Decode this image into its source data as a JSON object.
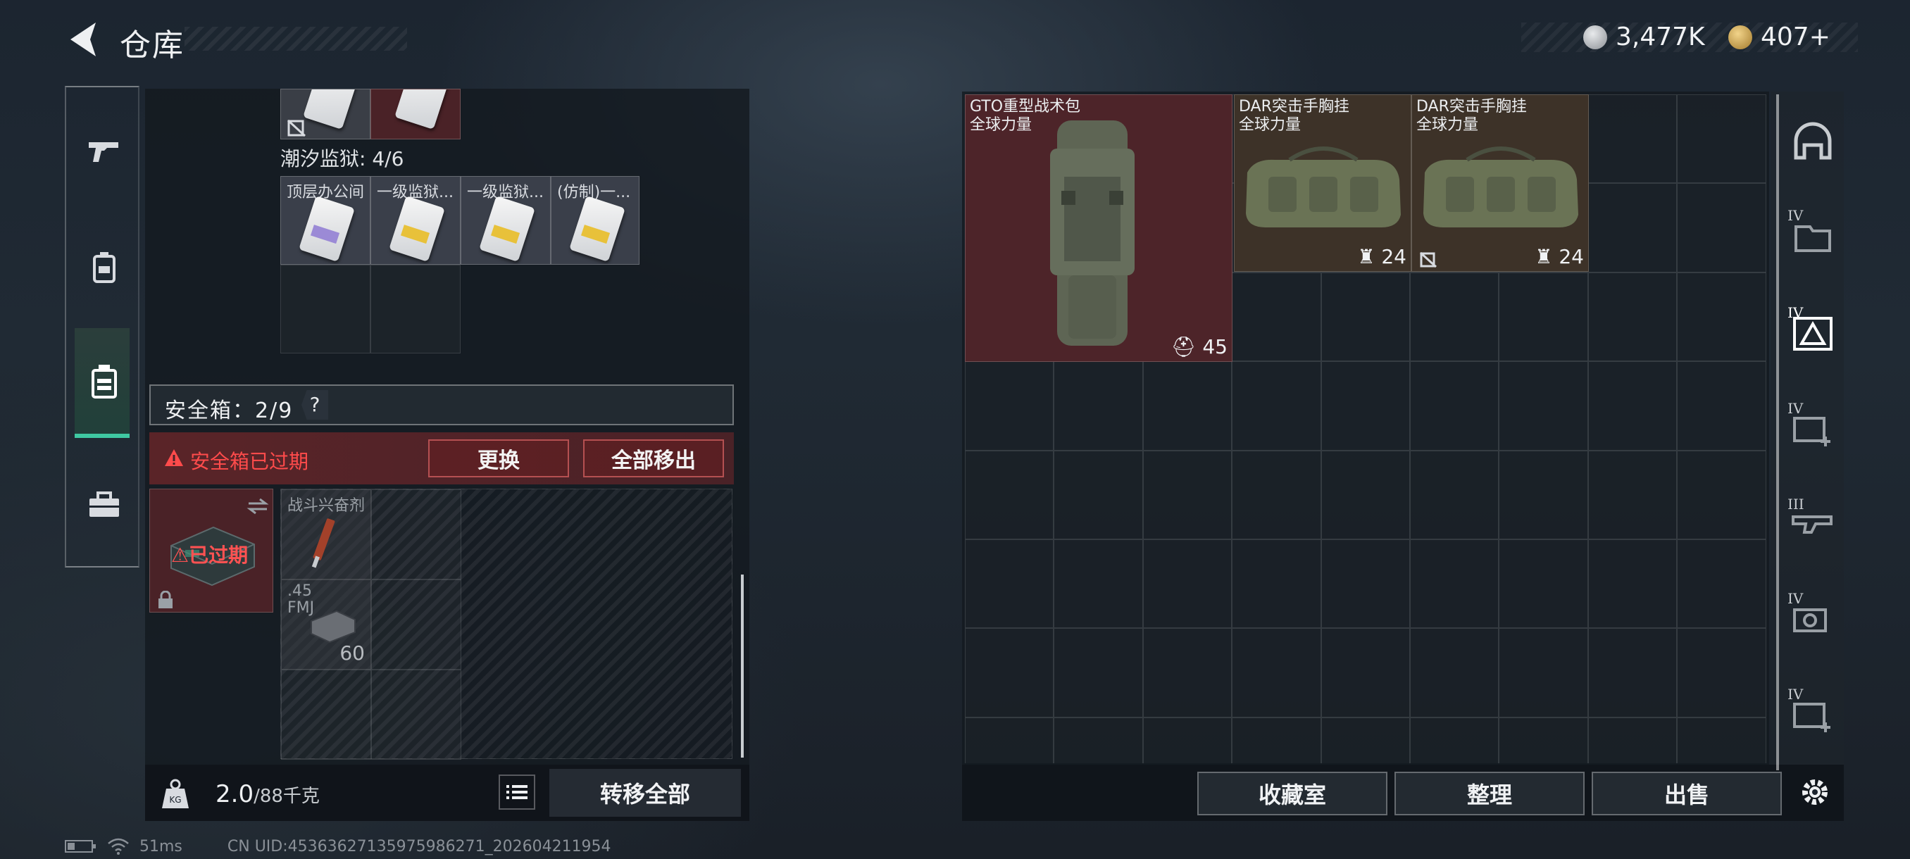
{
  "header": {
    "title": "仓库",
    "currency": [
      {
        "icon": "silver-coin-icon",
        "value": "3,477K"
      },
      {
        "icon": "gold-coin-icon",
        "value": "407+"
      }
    ]
  },
  "left_nav": {
    "items": [
      {
        "name": "weapons",
        "icon": "gun-icon"
      },
      {
        "name": "armor",
        "icon": "backpack-armor-icon"
      },
      {
        "name": "equipment",
        "icon": "chest-rig-icon",
        "active": true
      },
      {
        "name": "tools",
        "icon": "toolbox-icon"
      }
    ]
  },
  "left_panel": {
    "prison_label": "潮汐监狱: 4/6",
    "keycards": [
      {
        "label": "顶层办公间",
        "color": "purple"
      },
      {
        "label": "一级监狱...",
        "color": "yellow"
      },
      {
        "label": "一级监狱...",
        "color": "yellow"
      },
      {
        "label": "(仿制)一...",
        "color": "yellow"
      }
    ],
    "safe_box": {
      "label": "安全箱：2/9",
      "help": "?",
      "expired_text": "安全箱已过期",
      "replace_button": "更换",
      "remove_all_button": "全部移出",
      "thumb_overlay": "已过期",
      "items": [
        {
          "label": "战斗兴奋剂"
        },
        {
          "label": ".45 FMJ",
          "count": "60"
        }
      ]
    },
    "footer": {
      "weight": "2.0",
      "weight_max": "/88千克",
      "transfer_button": "转移全部"
    }
  },
  "right_panel": {
    "items": [
      {
        "name": "GTO重型战术包",
        "subtitle": "全球力量",
        "durability": "45"
      },
      {
        "name": "DAR突击手胸挂",
        "subtitle": "全球力量",
        "durability": "24"
      },
      {
        "name": "DAR突击手胸挂",
        "subtitle": "全球力量",
        "durability": "24"
      }
    ],
    "footer": {
      "collection_button": "收藏室",
      "sort_button": "整理",
      "sell_button": "出售"
    },
    "side_items": [
      {
        "icon": "helmet-icon",
        "roman": ""
      },
      {
        "icon": "folder-slot-icon",
        "roman": "IV"
      },
      {
        "icon": "warning-slot-icon",
        "roman": "IV"
      },
      {
        "icon": "medkit-plus-icon",
        "roman": "IV"
      },
      {
        "icon": "weapon-slot-icon",
        "roman": "III"
      },
      {
        "icon": "camera-slot-icon",
        "roman": "IV"
      },
      {
        "icon": "medkit-plus-icon",
        "roman": "IV"
      }
    ]
  },
  "status": {
    "ping": "51ms",
    "uid": "CN UID:45363627135975986271_202604211954"
  },
  "colors": {
    "accent": "#3fc9a2",
    "warning_red": "#ff4b4b",
    "selected_item_bg": "#4a2227"
  }
}
